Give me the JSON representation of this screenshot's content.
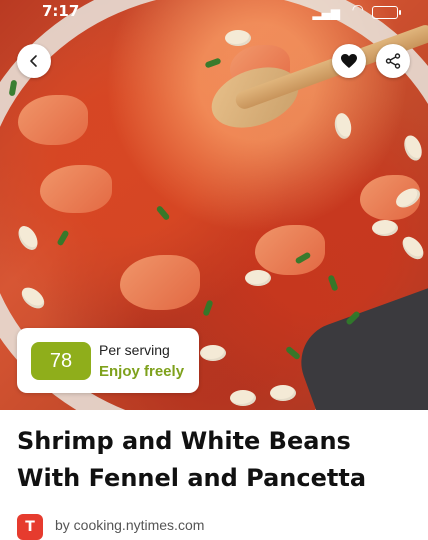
{
  "status_bar": {
    "time": "7:17"
  },
  "hero": {
    "image_alt": "Shrimp and white beans in a pan with fennel, tomatoes and herbs"
  },
  "nutrition": {
    "score": "78",
    "label": "Per serving",
    "verdict": "Enjoy freely",
    "score_color": "#8fae1b",
    "verdict_color": "#7ea11c"
  },
  "recipe": {
    "title": "Shrimp and White Beans With Fennel and Pancetta",
    "byline": "by cooking.nytimes.com",
    "source_logo_letter": "T"
  },
  "icons": {
    "back": "chevron-left-icon",
    "favorite": "heart-icon",
    "share": "share-icon"
  }
}
